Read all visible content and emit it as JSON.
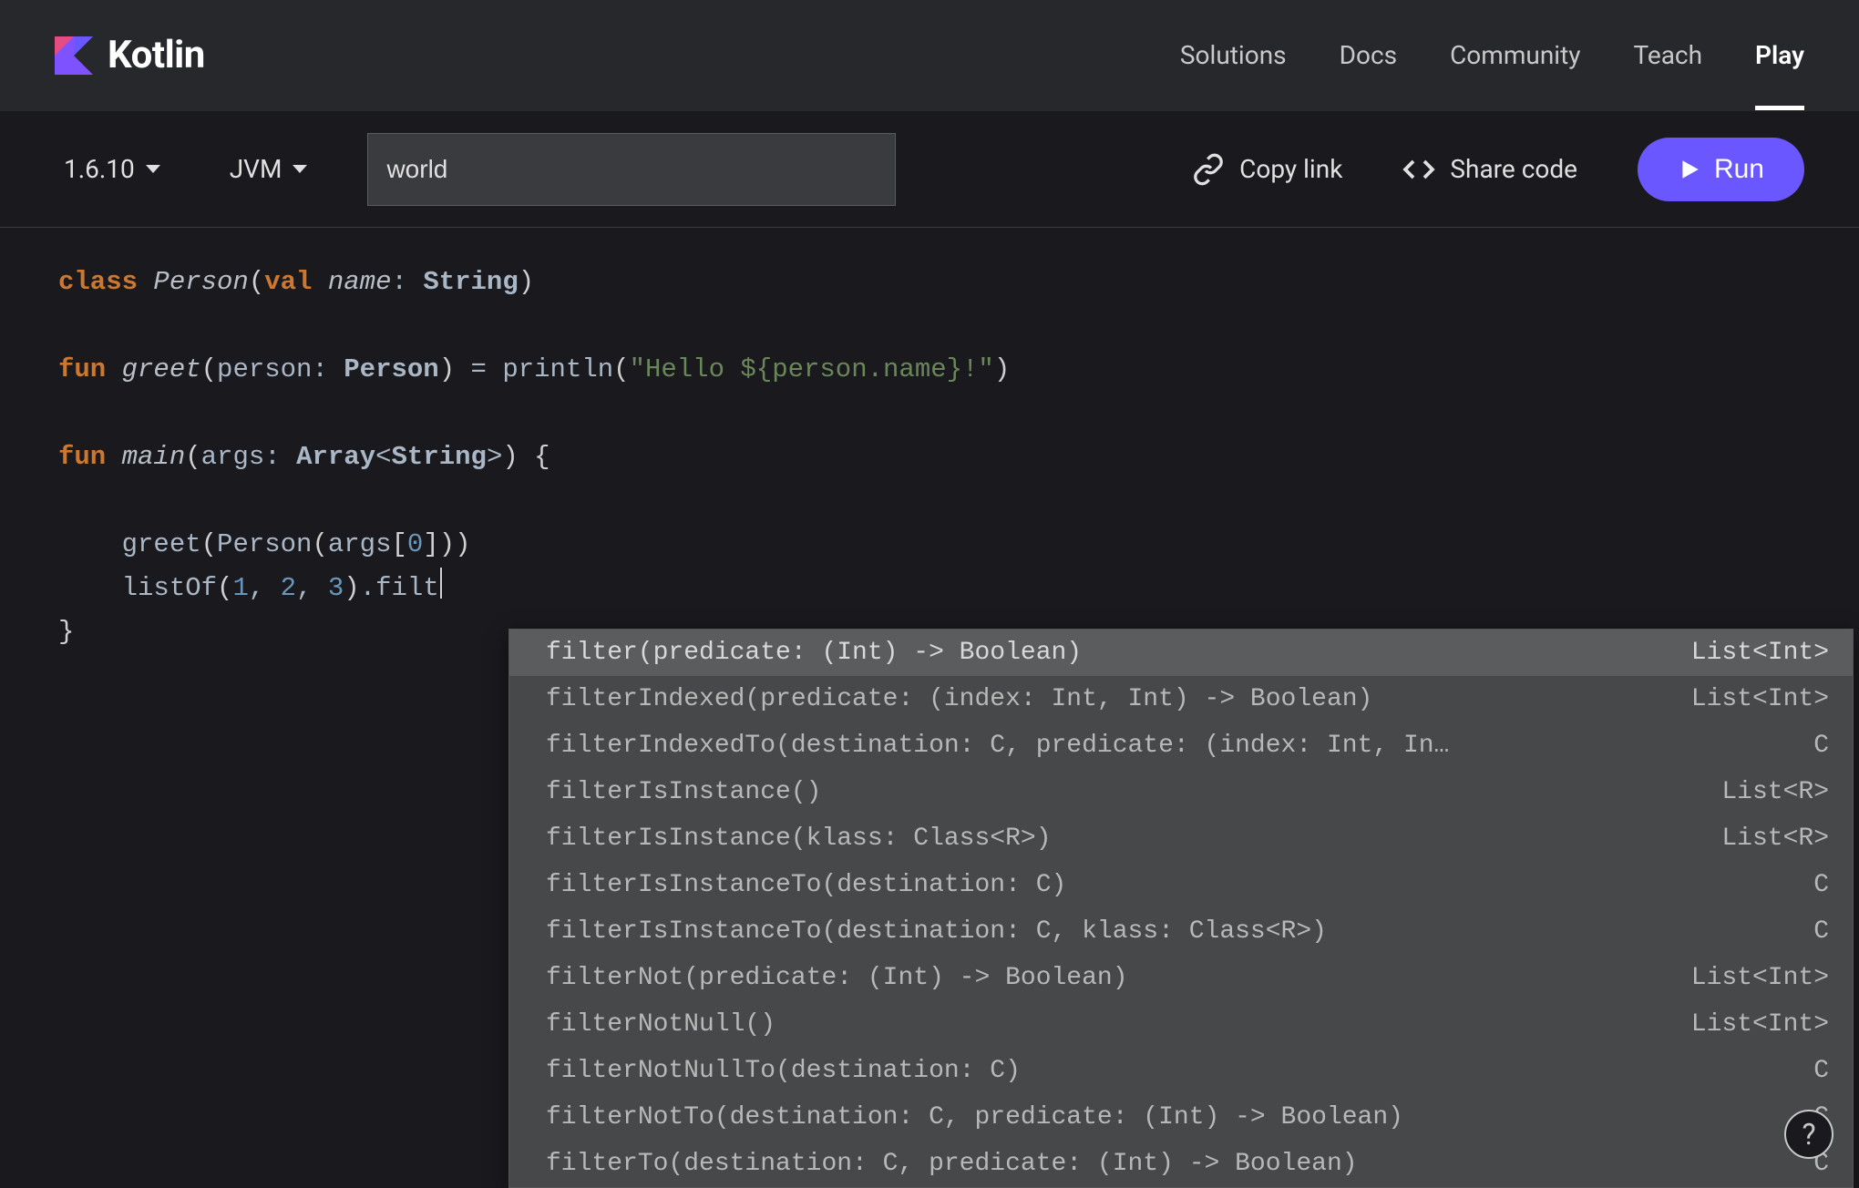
{
  "header": {
    "brand": "Kotlin",
    "nav": [
      "Solutions",
      "Docs",
      "Community",
      "Teach",
      "Play"
    ],
    "active": "Play"
  },
  "toolbar": {
    "version": "1.6.10",
    "platform": "JVM",
    "args_input": "world",
    "copy_link": "Copy link",
    "share_code": "Share code",
    "run": "Run"
  },
  "code": {
    "l1_class": "class",
    "l1_person": "Person",
    "l1_val": "val",
    "l1_name": "name",
    "l1_string": "String",
    "l3_fun": "fun",
    "l3_greet": "greet",
    "l3_person_param": "person",
    "l3_person_type": "Person",
    "l3_println": "println",
    "l3_str_open": "\"Hello ",
    "l3_interp": "${person.name}",
    "l3_str_close": "!\"",
    "l5_fun": "fun",
    "l5_main": "main",
    "l5_args": "args",
    "l5_array": "Array",
    "l5_string": "String",
    "l7_greet": "greet",
    "l7_person": "Person",
    "l7_args": "args",
    "l7_idx": "0",
    "l8_listof": "listOf",
    "l8_n1": "1",
    "l8_n2": "2",
    "l8_n3": "3",
    "l8_filt": "filt"
  },
  "autocomplete": {
    "items": [
      {
        "sig": "filter(predicate: (Int) -> Boolean)",
        "ret": "List<Int>",
        "selected": true
      },
      {
        "sig": "filterIndexed(predicate: (index: Int, Int) -> Boolean)",
        "ret": "List<Int>",
        "selected": false
      },
      {
        "sig": "filterIndexedTo(destination: C, predicate: (index: Int, In…",
        "ret": "C",
        "selected": false
      },
      {
        "sig": "filterIsInstance()",
        "ret": "List<R>",
        "selected": false
      },
      {
        "sig": "filterIsInstance(klass: Class<R>)",
        "ret": "List<R>",
        "selected": false
      },
      {
        "sig": "filterIsInstanceTo(destination: C)",
        "ret": "C",
        "selected": false
      },
      {
        "sig": "filterIsInstanceTo(destination: C, klass: Class<R>)",
        "ret": "C",
        "selected": false
      },
      {
        "sig": "filterNot(predicate: (Int) -> Boolean)",
        "ret": "List<Int>",
        "selected": false
      },
      {
        "sig": "filterNotNull()",
        "ret": "List<Int>",
        "selected": false
      },
      {
        "sig": "filterNotNullTo(destination: C)",
        "ret": "C",
        "selected": false
      },
      {
        "sig": "filterNotTo(destination: C, predicate: (Int) -> Boolean)",
        "ret": "C",
        "selected": false
      },
      {
        "sig": "filterTo(destination: C, predicate: (Int) -> Boolean)",
        "ret": "C",
        "selected": false
      }
    ]
  },
  "help_label": "?"
}
